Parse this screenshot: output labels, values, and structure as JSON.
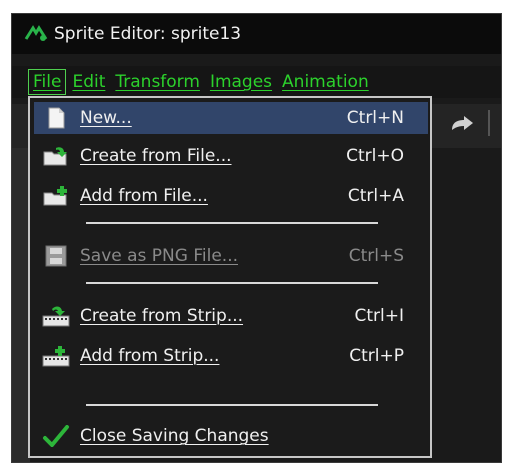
{
  "window": {
    "title": "Sprite Editor: sprite13"
  },
  "menubar": {
    "items": [
      {
        "label": "File"
      },
      {
        "label": "Edit"
      },
      {
        "label": "Transform"
      },
      {
        "label": "Images"
      },
      {
        "label": "Animation"
      }
    ]
  },
  "file_menu": {
    "items": [
      {
        "label": "New...",
        "shortcut": "Ctrl+N",
        "icon": "new-page-icon",
        "state": "highlighted"
      },
      {
        "label": "Create from File...",
        "shortcut": "Ctrl+O",
        "icon": "folder-open-icon",
        "state": "enabled"
      },
      {
        "label": "Add from File...",
        "shortcut": "Ctrl+A",
        "icon": "folder-add-icon",
        "state": "enabled"
      },
      {
        "label": "Save as PNG File...",
        "shortcut": "Ctrl+S",
        "icon": "save-disk-icon",
        "state": "disabled"
      },
      {
        "label": "Create from Strip...",
        "shortcut": "Ctrl+I",
        "icon": "strip-create-icon",
        "state": "enabled"
      },
      {
        "label": "Add from Strip...",
        "shortcut": "Ctrl+P",
        "icon": "strip-add-icon",
        "state": "enabled"
      },
      {
        "label": "Close Saving Changes",
        "shortcut": "",
        "icon": "checkmark-icon",
        "state": "enabled"
      }
    ]
  },
  "colors": {
    "menu_text": "#2cd12c",
    "highlight": "#31456a",
    "background": "#1a1a1a"
  }
}
